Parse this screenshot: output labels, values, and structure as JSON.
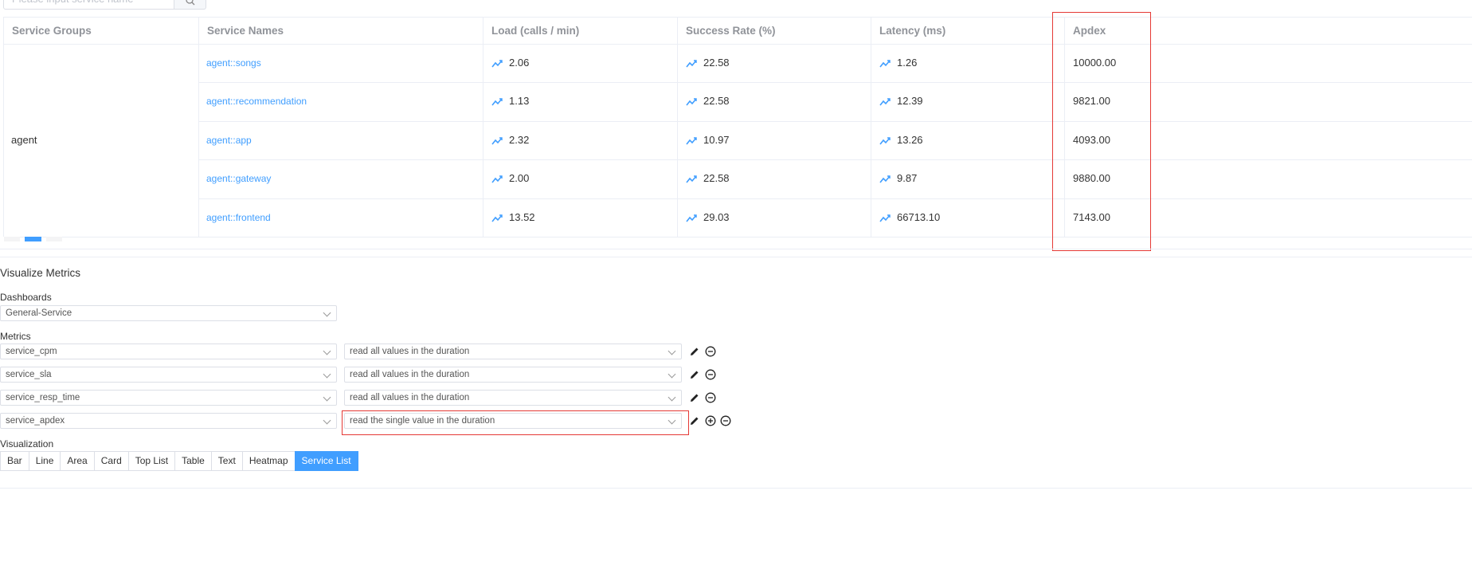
{
  "search": {
    "placeholder": "Please input service name"
  },
  "table": {
    "headers": [
      "Service Groups",
      "Service Names",
      "Load (calls / min)",
      "Success Rate (%)",
      "Latency (ms)",
      "Apdex"
    ],
    "group": "agent",
    "rows": [
      {
        "name": "agent::songs",
        "load": "2.06",
        "sla": "22.58",
        "latency": "1.26",
        "apdex": "10000.00"
      },
      {
        "name": "agent::recommendation",
        "load": "1.13",
        "sla": "22.58",
        "latency": "12.39",
        "apdex": "9821.00"
      },
      {
        "name": "agent::app",
        "load": "2.32",
        "sla": "10.97",
        "latency": "13.26",
        "apdex": "4093.00"
      },
      {
        "name": "agent::gateway",
        "load": "2.00",
        "sla": "22.58",
        "latency": "9.87",
        "apdex": "9880.00"
      },
      {
        "name": "agent::frontend",
        "load": "13.52",
        "sla": "29.03",
        "latency": "66713.10",
        "apdex": "7143.00"
      }
    ]
  },
  "visualize": {
    "title": "Visualize Metrics",
    "dashboards_label": "Dashboards",
    "dashboard_value": "General-Service",
    "metrics_label": "Metrics",
    "metrics": [
      {
        "name": "service_cpm",
        "mode": "read all values in the duration"
      },
      {
        "name": "service_sla",
        "mode": "read all values in the duration"
      },
      {
        "name": "service_resp_time",
        "mode": "read all values in the duration"
      },
      {
        "name": "service_apdex",
        "mode": "read the single value in the duration"
      }
    ],
    "visualization_label": "Visualization",
    "visualization_options": [
      "Bar",
      "Line",
      "Area",
      "Card",
      "Top List",
      "Table",
      "Text",
      "Heatmap",
      "Service List"
    ],
    "visualization_active": "Service List"
  },
  "colors": {
    "accent": "#409eff",
    "highlight": "#e53935"
  }
}
